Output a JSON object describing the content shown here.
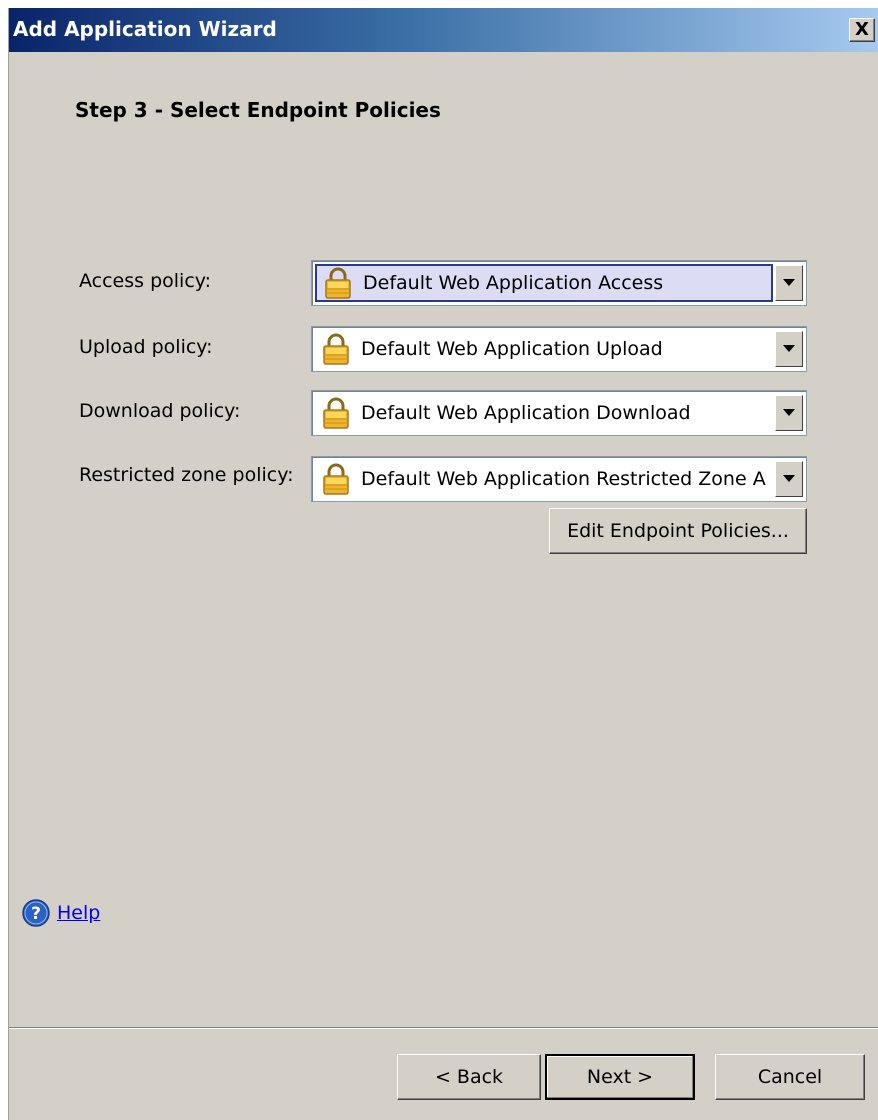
{
  "window": {
    "title": "Add Application Wizard",
    "close_label": "X"
  },
  "step": {
    "title": "Step 3 - Select Endpoint Policies"
  },
  "policies": [
    {
      "label": "Access policy:",
      "value": "Default Web Application Access",
      "icon": "lock-icon",
      "focused": true
    },
    {
      "label": "Upload policy:",
      "value": "Default Web Application Upload",
      "icon": "lock-icon",
      "focused": false
    },
    {
      "label": "Download policy:",
      "value": "Default Web Application Download",
      "icon": "lock-icon",
      "focused": false
    },
    {
      "label": "Restricted zone policy:",
      "value": "Default Web Application Restricted Zone A",
      "icon": "lock-icon",
      "focused": false
    }
  ],
  "edit_button": {
    "label": "Edit Endpoint Policies..."
  },
  "help": {
    "label": "Help",
    "icon": "help-icon"
  },
  "footer": {
    "back_label": "< Back",
    "next_label": "Next >",
    "cancel_label": "Cancel"
  },
  "colors": {
    "window_bg": "#d4d0c8",
    "title_gradient_start": "#0a246a",
    "title_gradient_end": "#a6caf0",
    "focus_bg": "#dcdcf5",
    "link": "#0000ee"
  }
}
